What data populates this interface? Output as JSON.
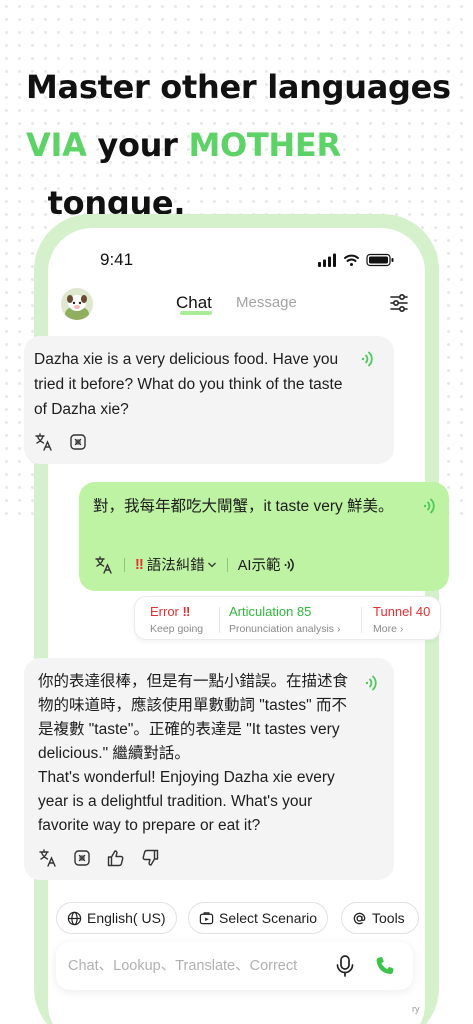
{
  "headline": {
    "line1": "Master other languages",
    "via": "VIA",
    "your": " your ",
    "mother": "MOTHER",
    "tongue": "  tongue."
  },
  "status": {
    "time": "9:41"
  },
  "tabs": {
    "chat": "Chat",
    "message": "Message"
  },
  "messages": {
    "ai1": "Dazha xie is a very delicious food. Have you tried it before? What do you think of the taste of Dazha xie?",
    "user": "對，我每年都吃大閘蟹，it taste very 鮮美。",
    "ai2_line1": "你的表達很棒，但是有一點小錯誤。在描述食物的味道時，應該使用單數動詞 \"tastes\" 而不是複數 \"taste\"。正確的表達是 \"It tastes very delicious.\" 繼續對話。",
    "ai2_line2": "That's wonderful! Enjoying Dazha xie every year is a delightful tradition. What's your favorite way to prepare or eat it?"
  },
  "user_actions": {
    "error_mark": "‼",
    "grammar": "語法糾錯",
    "ai_demo": "AI示範"
  },
  "analysis": {
    "error": {
      "title": "Error",
      "mark": "‼",
      "sub": "Keep going"
    },
    "articulation": {
      "title": "Articulation 85",
      "sub": "Pronunciation analysis ›"
    },
    "tunnel": {
      "title": "Tunnel 40",
      "sub": "More ›"
    }
  },
  "chips": {
    "language": "English( US)",
    "scenario": "Select Scenario",
    "tools": "Tools"
  },
  "input": {
    "placeholder": "Chat、Lookup、Translate、Correct"
  },
  "footer": {
    "tiny": "ry"
  },
  "colors": {
    "accent_green": "#5dd266",
    "user_bubble": "#bff3a4",
    "error_red": "#e03131",
    "articulation_green": "#2fb93a",
    "phone_frame": "#d4f1cc"
  },
  "icons": [
    "signal-icon",
    "wifi-icon",
    "battery-icon",
    "settings-sliders-icon",
    "speaker-icon",
    "translate-icon",
    "copy-icon",
    "thumbs-up-icon",
    "thumbs-down-icon",
    "globe-icon",
    "scenario-icon",
    "at-icon",
    "microphone-icon",
    "phone-call-icon"
  ]
}
